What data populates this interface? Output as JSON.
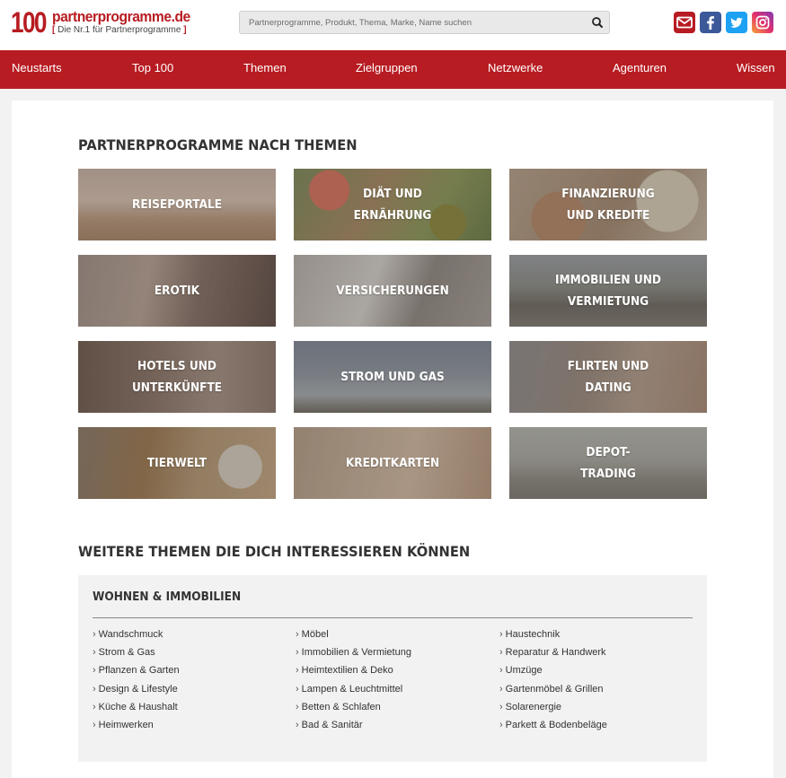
{
  "header": {
    "logo_number": "100",
    "logo_name": "partnerprogramme.de",
    "logo_tagline": "Die Nr.1 für Partnerprogramme",
    "search_placeholder": "Partnerprogramme, Produkt, Thema, Marke, Name suchen",
    "social_icons": [
      "mail-icon",
      "facebook-icon",
      "twitter-icon",
      "instagram-icon"
    ]
  },
  "nav": {
    "items": [
      "Neustarts",
      "Top 100",
      "Themen",
      "Zielgruppen",
      "Netzwerke",
      "Agenturen",
      "Wissen"
    ]
  },
  "themes": {
    "heading": "PARTNERPROGRAMME NACH THEMEN",
    "tiles": [
      "Reiseportale",
      "Diät und\nErnährung",
      "Finanzierung\nund Kredite",
      "Erotik",
      "Versicherungen",
      "Immobilien und Vermietung",
      "Hotels und\nUnterkünfte",
      "Strom und Gas",
      "Flirten und\nDating",
      "Tierwelt",
      "Kreditkarten",
      "Depot-\nTrading"
    ]
  },
  "more": {
    "heading": "WEITERE THEMEN DIE DICH INTERESSIEREN KÖNNEN",
    "box_title": "WOHNEN & IMMOBILIEN",
    "columns": [
      [
        "Wandschmuck",
        "Strom & Gas",
        "Pflanzen & Garten",
        "Design & Lifestyle",
        "Küche & Haushalt",
        "Heimwerken"
      ],
      [
        "Möbel",
        "Immobilien & Vermietung",
        "Heimtextilien & Deko",
        "Lampen & Leuchtmittel",
        "Betten & Schlafen",
        "Bad & Sanitär"
      ],
      [
        "Haustechnik",
        "Reparatur & Handwerk",
        "Umzüge",
        "Gartenmöbel & Grillen",
        "Solarenergie",
        "Parkett & Bodenbeläge"
      ]
    ]
  },
  "colors": {
    "brand_red": "#b71c22",
    "facebook": "#3b5998",
    "twitter": "#1da1f2"
  }
}
